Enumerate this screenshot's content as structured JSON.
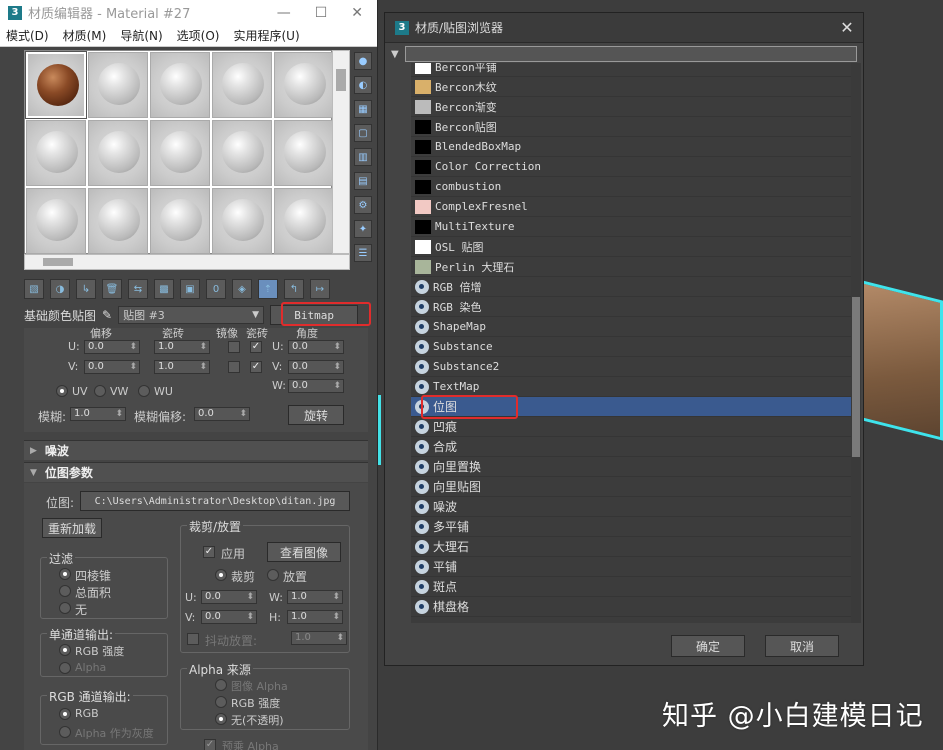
{
  "viewport": {
    "label": "[+"
  },
  "editor": {
    "title": "材质编辑器 - Material #27",
    "menu": [
      "模式(D)",
      "材质(M)",
      "导航(N)",
      "选项(O)",
      "实用程序(U)"
    ],
    "map_label": "基础颜色贴图",
    "map_name": "贴图 #3",
    "map_type": "Bitmap",
    "coords": {
      "headers": [
        "偏移",
        "瓷砖",
        "镜像",
        "瓷砖",
        "角度"
      ],
      "u_offset": "0.0",
      "v_offset": "0.0",
      "u_tile": "1.0",
      "v_tile": "1.0",
      "u_angle": "0.0",
      "v_angle": "0.0",
      "w_angle": "0.0",
      "u": "U:",
      "v": "V:",
      "w": "W:",
      "uv": "UV",
      "vw": "VW",
      "wu": "WU",
      "blur_label": "模糊:",
      "blur": "1.0",
      "blur_offset_label": "模糊偏移:",
      "blur_offset": "0.0",
      "rotate": "旋转"
    },
    "rollouts": {
      "noise": "噪波",
      "bitmap_params": "位图参数"
    },
    "bitmap": {
      "path_label": "位图:",
      "path": "C:\\Users\\Administrator\\Desktop\\ditan.jpg",
      "reload": "重新加载",
      "crop_group": "裁剪/放置",
      "apply": "应用",
      "view_image": "查看图像",
      "crop": "裁剪",
      "place": "放置",
      "u": "0.0",
      "v": "0.0",
      "w": "1.0",
      "h": "1.0",
      "jitter_label": "抖动放置:",
      "jitter": "1.0",
      "filter_group": "过滤",
      "filter_options": [
        "四棱锥",
        "总面积",
        "无"
      ],
      "mono_group": "单通道输出:",
      "mono_options": [
        "RGB 强度",
        "Alpha"
      ],
      "rgb_group": "RGB 通道输出:",
      "rgb_options": [
        "RGB",
        "Alpha 作为灰度"
      ],
      "alpha_group": "Alpha 来源",
      "alpha_options": [
        "图像 Alpha",
        "RGB 强度",
        "无(不透明)"
      ],
      "premult": "预乘 Alpha"
    }
  },
  "browser": {
    "title": "材质/贴图浏览器",
    "items": [
      {
        "label": "Bercon平铺",
        "icon": "swatch",
        "color": "#ffffff",
        "mono": true
      },
      {
        "label": "Bercon木纹",
        "icon": "swatch",
        "color": "#d9b06a",
        "mono": true
      },
      {
        "label": "Bercon渐变",
        "icon": "swatch",
        "color": "#bbbbbb",
        "mono": true
      },
      {
        "label": "Bercon贴图",
        "icon": "swatch",
        "color": "#000000",
        "mono": true
      },
      {
        "label": "BlendedBoxMap",
        "icon": "swatch",
        "color": "#000000",
        "mono": true
      },
      {
        "label": "Color Correction",
        "icon": "swatch",
        "color": "#000000",
        "mono": true
      },
      {
        "label": "combustion",
        "icon": "swatch",
        "color": "#000000",
        "mono": true
      },
      {
        "label": "ComplexFresnel",
        "icon": "swatch",
        "color": "#f2c9c4",
        "mono": true
      },
      {
        "label": "MultiTexture",
        "icon": "swatch",
        "color": "#000000",
        "mono": true
      },
      {
        "label": "OSL 贴图",
        "icon": "swatch",
        "color": "#ffffff",
        "mono": true
      },
      {
        "label": "Perlin 大理石",
        "icon": "swatch",
        "color": "#a8b59a",
        "mono": true
      },
      {
        "label": "RGB 倍增",
        "icon": "eye",
        "mono": true
      },
      {
        "label": "RGB 染色",
        "icon": "eye",
        "mono": true
      },
      {
        "label": "ShapeMap",
        "icon": "eye",
        "mono": true
      },
      {
        "label": "Substance",
        "icon": "eye",
        "mono": true
      },
      {
        "label": "Substance2",
        "icon": "eye",
        "mono": true
      },
      {
        "label": "TextMap",
        "icon": "eye",
        "mono": true
      },
      {
        "label": "位图",
        "icon": "eye",
        "mono": false,
        "selected": true
      },
      {
        "label": "凹痕",
        "icon": "eye",
        "mono": false
      },
      {
        "label": "合成",
        "icon": "eye",
        "mono": false
      },
      {
        "label": "向里置换",
        "icon": "eye",
        "mono": false
      },
      {
        "label": "向里贴图",
        "icon": "eye",
        "mono": false
      },
      {
        "label": "噪波",
        "icon": "eye",
        "mono": false
      },
      {
        "label": "多平铺",
        "icon": "eye",
        "mono": false
      },
      {
        "label": "大理石",
        "icon": "eye",
        "mono": false
      },
      {
        "label": "平铺",
        "icon": "eye",
        "mono": false
      },
      {
        "label": "斑点",
        "icon": "eye",
        "mono": false
      },
      {
        "label": "棋盘格",
        "icon": "eye",
        "mono": false
      }
    ],
    "ok": "确定",
    "cancel": "取消"
  },
  "watermark": "知乎 @小白建模日记",
  "colors": {
    "highlight": "#e02c2c",
    "selection": "#3a5a8f",
    "accent": "#43e2e8"
  }
}
